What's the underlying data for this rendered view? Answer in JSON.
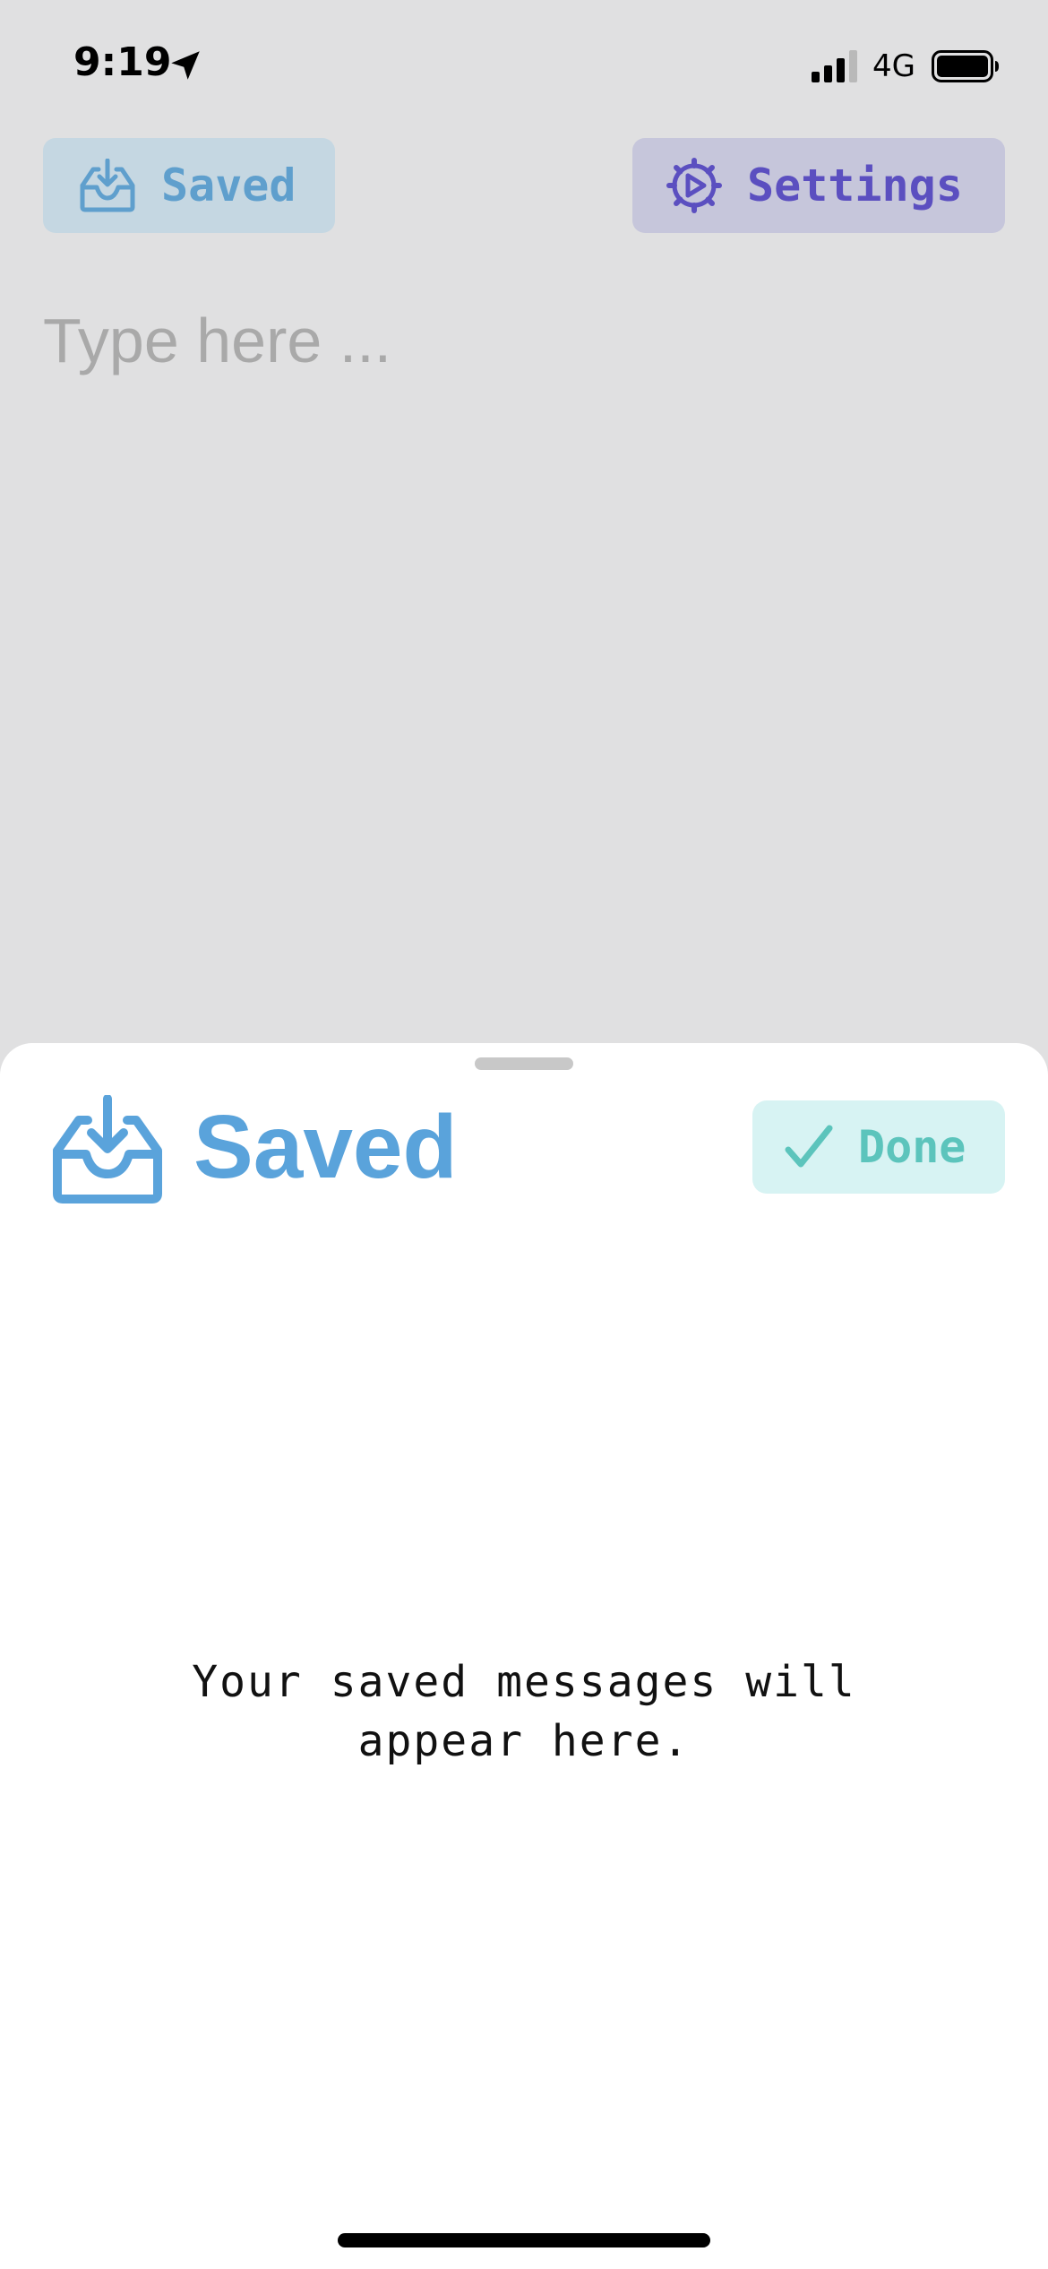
{
  "status_bar": {
    "time": "9:19",
    "network": "4G"
  },
  "toolbar": {
    "saved_label": "Saved",
    "settings_label": "Settings"
  },
  "editor": {
    "placeholder": "Type here ..."
  },
  "sheet": {
    "title": "Saved",
    "done_label": "Done",
    "empty_message": "Your saved messages will\nappear here."
  },
  "colors": {
    "saved_accent": "#5aa3db",
    "settings_accent": "#5b4fc0",
    "done_accent": "#5cc4bc"
  },
  "icons": {
    "saved": "inbox-download-icon",
    "settings": "gear-icon",
    "done": "checkmark-icon"
  }
}
